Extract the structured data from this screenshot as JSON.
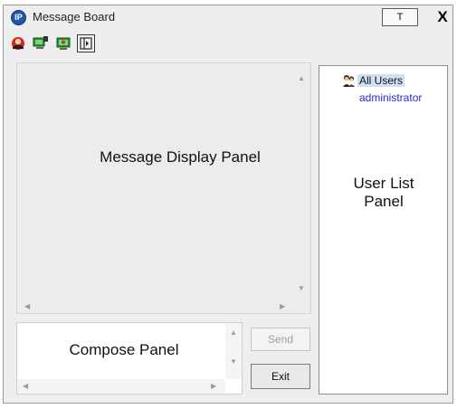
{
  "window": {
    "title": "Message Board",
    "app_icon_text": "IP",
    "pin_label": "T",
    "close_label": "X"
  },
  "toolbar": {
    "icons": [
      "user-status-icon",
      "broadcast-icon",
      "private-message-icon",
      "panel-toggle-icon"
    ]
  },
  "message_display": {
    "label": "Message Display Panel"
  },
  "user_list": {
    "label": "User List Panel",
    "all_users": "All Users",
    "users": [
      "administrator"
    ]
  },
  "compose": {
    "label": "Compose Panel"
  },
  "buttons": {
    "send": "Send",
    "exit": "Exit"
  },
  "colors": {
    "accent_blue": "#1f5aa8",
    "user_name": "#2a2ad8",
    "selection": "#cfe0f4"
  }
}
